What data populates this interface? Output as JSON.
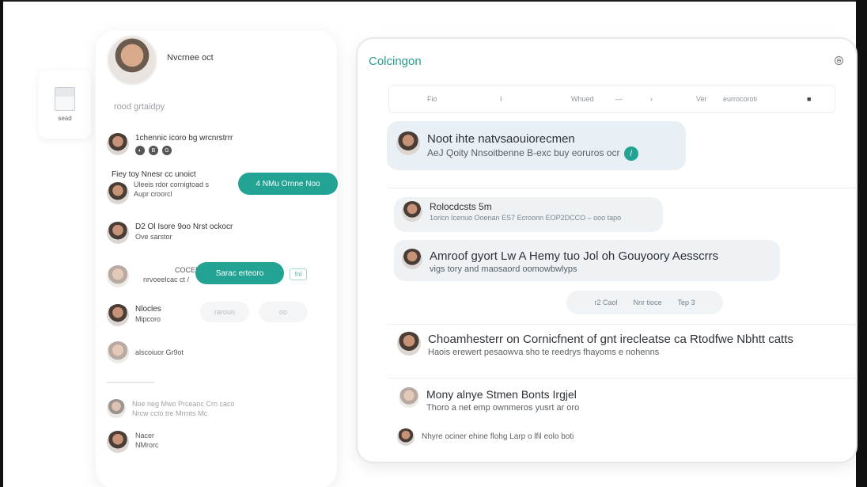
{
  "file_card": {
    "label": "sead"
  },
  "profile": {
    "name": "Nvcrnee oct"
  },
  "left_section_label": "rood grtaidpy",
  "contacts": [
    {
      "line1": "1chennic icoro bg wrcnrstrrr",
      "line2": ""
    },
    {
      "line1": "Fiey toy Nnesr cc unoict",
      "line2": "Uleeis rdor cornigtoad s",
      "line3": "Aupr croorcl"
    },
    {
      "line1": "D2 Ol Isore 9oo Nrst ockocr",
      "line2": "Ove sarstor"
    },
    {
      "line1": "COCENK",
      "line2": "nrvoeelcac ct /"
    },
    {
      "line1": "Nlocles",
      "line2": "Mipcoro"
    },
    {
      "line1": "alscoiuor Gr9ot",
      "line2": ""
    },
    {
      "line1": "Noe neg Mwo Prceanc Crn caco",
      "line2": "Nrcw ccto tre Mrrnts Mc"
    },
    {
      "line1": "Nacer",
      "line2": "NMrorc"
    }
  ],
  "left_pills": {
    "teal1": "4 NMu Ornne Noo",
    "teal2": "Sarac erteoro",
    "ghost1": "raroun",
    "ghost2": "oo",
    "square": "fnl"
  },
  "main": {
    "title": "Colcingon",
    "toolbar": [
      "Fio",
      "I",
      "Whued",
      "—",
      "Ver",
      "eurrocoroti"
    ],
    "messages": [
      {
        "line1": "Noot ihte natvsaouiorecmen",
        "line2": "AeJ Qoity Nnsoitbenne B-exc buy eoruros ocr"
      },
      {
        "line1": "Rolocdcsts 5m",
        "line2": "1oricn Icenuo Ooenan ES7 Ecroonn EOP2DCCO – ooo tapo"
      },
      {
        "line1": "Amroof gyort Lw A Hemy tuo Jol oh Gouyoory Aesscrrs",
        "line2": "vigs tory and maosaord oomowbwlyps"
      },
      {
        "line1": "Choamhesterr on Cornicfnent of gnt irecleatse ca Rtodfwe Nbhtt catts",
        "line2": "Haois erewert pesaowva sho te reedrys fhayoms e nohenns"
      },
      {
        "line1": "Mony alnye Stmen Bonts Irgjel",
        "line2": "Thoro a net emp ownmeros yusrt ar oro"
      },
      {
        "line1": "Nhyre ociner ehine flohg Larp o lfil eolo boti",
        "line2": ""
      }
    ],
    "center_chip": {
      "left": "r2 Caol",
      "mid": "Nnr tioce",
      "right": "Tep 3"
    }
  }
}
